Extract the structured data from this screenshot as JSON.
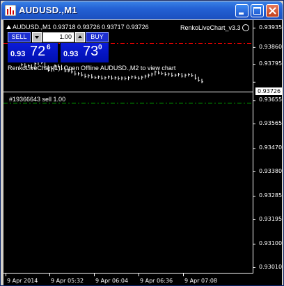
{
  "window": {
    "title": "AUDUSD.,M1",
    "controls": [
      "minimize-icon",
      "maximize-icon",
      "close-icon"
    ]
  },
  "colors": {
    "titlebar": "#2461d4",
    "chart_bg": "#000000",
    "candles": "#ffffff",
    "ask_line": "#ff0000",
    "order_line": "#00b000",
    "panel_blue": "#0b1bd8"
  },
  "chart": {
    "symbol_line": "AUDUSD.,M1  0.93718 0.93726 0.93717 0.93726",
    "indicator_name": "RenkoLiveChart_v3.3",
    "comment": "RenkoLiveChart(1): Open Offline AUDUSD.,M2 to view chart",
    "order_label": "#19366643 sell 1.00",
    "current_price": "0.93726",
    "price_labels": [
      "0.93935",
      "0.93860",
      "0.93795",
      "0.93726",
      "0.93655",
      "0.93565",
      "0.93470",
      "0.93380",
      "0.93285",
      "0.93195",
      "0.93100",
      "0.93010"
    ],
    "time_labels": [
      "9 Apr 2014",
      "9 Apr 05:32",
      "9 Apr 06:04",
      "9 Apr 06:36",
      "9 Apr 07:08"
    ]
  },
  "one_click": {
    "sell_label": "SELL",
    "buy_label": "BUY",
    "lot": "1.00",
    "bid": {
      "prefix": "0.93",
      "big": "72",
      "sup": "6"
    },
    "ask": {
      "prefix": "0.93",
      "big": "73",
      "sup": "0"
    }
  },
  "chart_data": {
    "type": "line",
    "title": "AUDUSD.,M1",
    "y_axis_range": [
      0.9301,
      0.9394
    ],
    "series": [
      {
        "values": [
          0.93792,
          0.93785,
          0.93788,
          0.9378,
          0.93796,
          0.93806,
          0.938,
          0.93784,
          0.9377,
          0.93778,
          0.93788,
          0.93786,
          0.93776,
          0.93768,
          0.93772,
          0.93764,
          0.93756,
          0.93758,
          0.93752,
          0.93746,
          0.9375,
          0.93744,
          0.93742,
          0.93745,
          0.9374,
          0.93742,
          0.93745,
          0.9374,
          0.93742,
          0.93738,
          0.93741,
          0.93738,
          0.93742,
          0.93745,
          0.93742,
          0.9374,
          0.93744,
          0.93748,
          0.93752,
          0.93756,
          0.93764,
          0.9376,
          0.93758,
          0.93754,
          0.93756,
          0.9375,
          0.93752,
          0.93755,
          0.93748,
          0.93752,
          0.93754,
          0.9375,
          0.9374,
          0.93732,
          0.93726
        ]
      }
    ]
  }
}
